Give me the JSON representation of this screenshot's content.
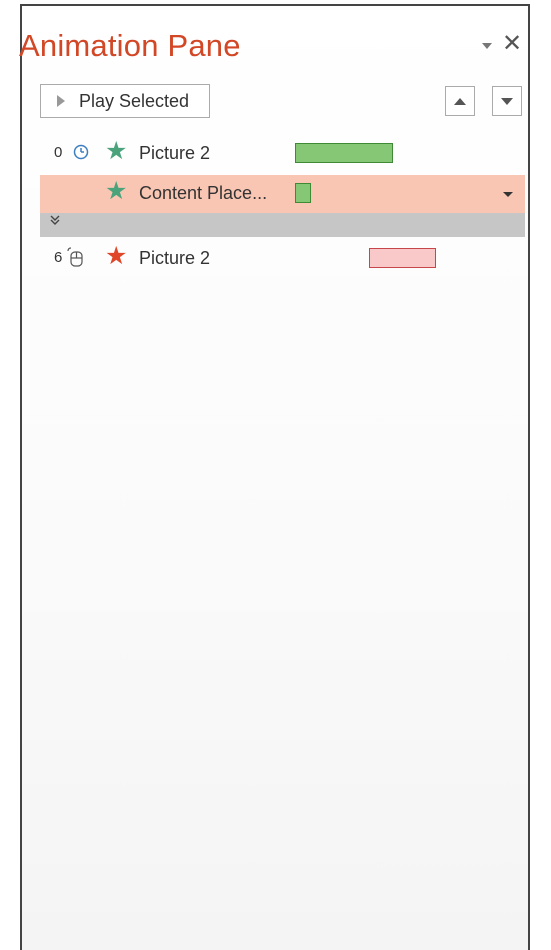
{
  "pane": {
    "title": "Animation Pane",
    "options_icon": "pane-options-icon",
    "close_icon": "close-icon",
    "close_glyph": "✕"
  },
  "toolbar": {
    "play_label": "Play Selected",
    "move_up_icon": "triangle-up-icon",
    "move_down_icon": "triangle-down-icon"
  },
  "animations": [
    {
      "number": "0",
      "trigger_icon": "clock-icon",
      "effect_icon": "star-icon",
      "effect_color": "#4ba37c",
      "label": "Picture 2",
      "bar_fill": "#86c775",
      "bar_border": "#3e8a35"
    },
    {
      "number": "",
      "trigger_icon": "",
      "effect_icon": "star-icon",
      "effect_color": "#4ba37c",
      "label": "Content Place...",
      "bar_fill": "#86c775",
      "bar_border": "#3e8a35",
      "selected": true,
      "dropdown_icon": "dropdown-arrow-icon"
    },
    {
      "number": "6",
      "trigger_icon": "mouse-click-icon",
      "effect_icon": "star-icon",
      "effect_color": "#e0462a",
      "label": "Picture 2",
      "bar_fill": "#f9c8c8",
      "bar_border": "#c6464a"
    }
  ],
  "collapse": {
    "icon": "collapse-chevrons-icon",
    "glyph": "¥"
  },
  "colors": {
    "title": "#d24726",
    "selected_row": "#f9c6b3",
    "collapse_bar": "#c6c6c6"
  }
}
